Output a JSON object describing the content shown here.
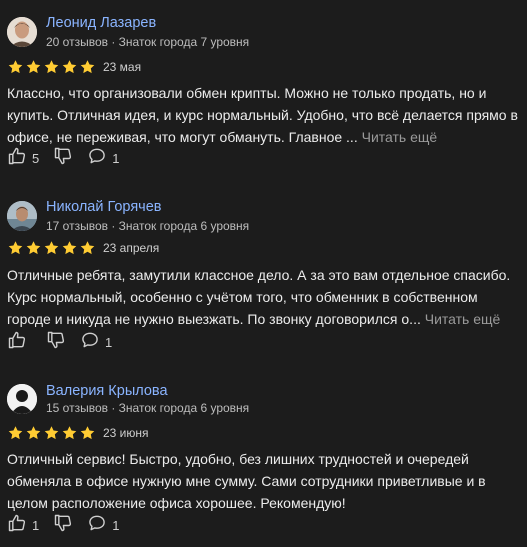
{
  "reviews": [
    {
      "name": "Леонид Лазарев",
      "meta": "20 отзывов · Знаток города 7 уровня",
      "rating": 5,
      "date": "23 мая",
      "text": "Классно, что организовали обмен крипты. Можно не только продать, но и купить. Отличная идея, и курс нормальный. Удобно, что всё делается прямо в офисе, не переживая, что могут обмануть. Главное ...",
      "more": "Читать ещё",
      "likes": "5",
      "comments": "1"
    },
    {
      "name": "Николай Горячев",
      "meta": "17 отзывов · Знаток города 6 уровня",
      "rating": 5,
      "date": "23 апреля",
      "text": "Отличные ребята, замутили классное дело. А за это вам отдельное спасибо. Курс нормальный, особенно с учётом того, что обменник в собственном городе и никуда не нужно выезжать. По звонку договорился о...",
      "more": "Читать ещё",
      "likes": "",
      "comments": "1"
    },
    {
      "name": "Валерия Крылова",
      "meta": "15 отзывов · Знаток города 6 уровня",
      "rating": 5,
      "date": "23 июня",
      "text": "Отличный сервис! Быстро, удобно, без лишних трудностей и очередей обменяла в офисе нужную мне сумму. Сами сотрудники приветливые и в целом расположение офиса хорошее. Рекомендую!",
      "more": "",
      "likes": "1",
      "comments": "1"
    }
  ],
  "colors": {
    "background": "#1c1c1c",
    "name": "#8ab4ff",
    "star": "#fc3",
    "more_link": "#9a9a9a"
  },
  "icons": [
    "thumbs-up-icon",
    "thumbs-down-icon",
    "comment-icon"
  ]
}
